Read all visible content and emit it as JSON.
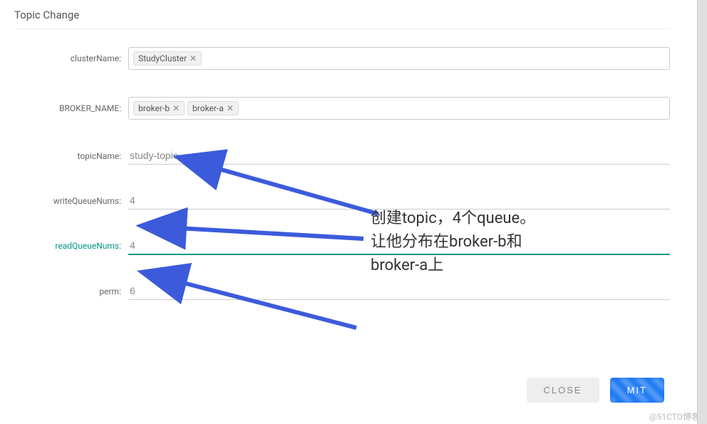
{
  "dialog": {
    "title": "Topic Change"
  },
  "form": {
    "clusterName": {
      "label": "clusterName:",
      "tags": [
        "StudyCluster"
      ]
    },
    "brokerName": {
      "label": "BROKER_NAME:",
      "tags": [
        "broker-b",
        "broker-a"
      ]
    },
    "topicName": {
      "label": "topicName:",
      "value": "study-topic"
    },
    "writeQueueNums": {
      "label": "writeQueueNums:",
      "value": "4"
    },
    "readQueueNums": {
      "label": "readQueueNums:",
      "value": "4"
    },
    "perm": {
      "label": "perm:",
      "value": "6"
    }
  },
  "footer": {
    "close": "CLOSE",
    "commit": "MIT"
  },
  "annotation": {
    "line1": "创建topic，4个queue。",
    "line2": "让他分布在broker-b和",
    "line3": "broker-a上"
  },
  "watermark": "@51CTO博客"
}
